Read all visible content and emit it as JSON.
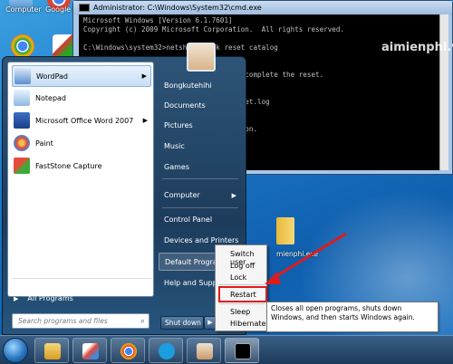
{
  "desktop": {
    "icons": [
      {
        "label": "Computer"
      },
      {
        "label": "Google Do"
      }
    ],
    "folder_label": "mienphi.exe"
  },
  "cmd": {
    "title": "Administrator: C:\\Windows\\System32\\cmd.exe",
    "lines": [
      "Microsoft Windows [Version 6.1.7601]",
      "Copyright (c) 2009 Microsoft Corporation.  All rights reserved.",
      "",
      "C:\\Windows\\system32>netsh winsock reset catalog",
      "",
      "                              talog.",
      "                              order to complete the reset.",
      "",
      "",
      "                              reset reset.log",
      "",
      "",
      "                              this action.",
      ""
    ],
    "watermark": "aimienphi.vn"
  },
  "start_menu": {
    "user": "Bongkutehihi",
    "programs": [
      {
        "label": "WordPad",
        "icon": "wordpad-icon",
        "has_submenu": true
      },
      {
        "label": "Notepad",
        "icon": "notepad-icon",
        "has_submenu": false
      },
      {
        "label": "Microsoft Office Word 2007",
        "icon": "word-icon",
        "has_submenu": true
      },
      {
        "label": "Paint",
        "icon": "paint-icon",
        "has_submenu": false
      },
      {
        "label": "FastStone Capture",
        "icon": "faststone-icon",
        "has_submenu": false
      }
    ],
    "all_programs": "All Programs",
    "search_placeholder": "Search programs and files",
    "right_items": [
      {
        "label": "Bongkutehihi",
        "has_submenu": false
      },
      {
        "label": "Documents",
        "has_submenu": false
      },
      {
        "label": "Pictures",
        "has_submenu": false
      },
      {
        "label": "Music",
        "has_submenu": false
      },
      {
        "label": "Games",
        "has_submenu": false
      },
      {
        "label": "Computer",
        "has_submenu": true
      },
      {
        "label": "Control Panel",
        "has_submenu": false
      },
      {
        "label": "Devices and Printers",
        "has_submenu": false
      },
      {
        "label": "Default Programs",
        "has_submenu": false
      },
      {
        "label": "Help and Support",
        "has_submenu": false
      }
    ],
    "shutdown_label": "Shut down",
    "shutdown_arrow": "▶"
  },
  "shutdown_submenu": {
    "items": [
      "Switch user",
      "Log off",
      "Lock",
      "Restart",
      "Sleep",
      "Hibernate"
    ],
    "highlighted": "Restart"
  },
  "tooltip": {
    "text": "Closes all open programs, shuts down Windows, and then starts Windows again."
  },
  "colors": {
    "highlight_box": "#e01b1b",
    "arrow": "#e01b1b"
  }
}
